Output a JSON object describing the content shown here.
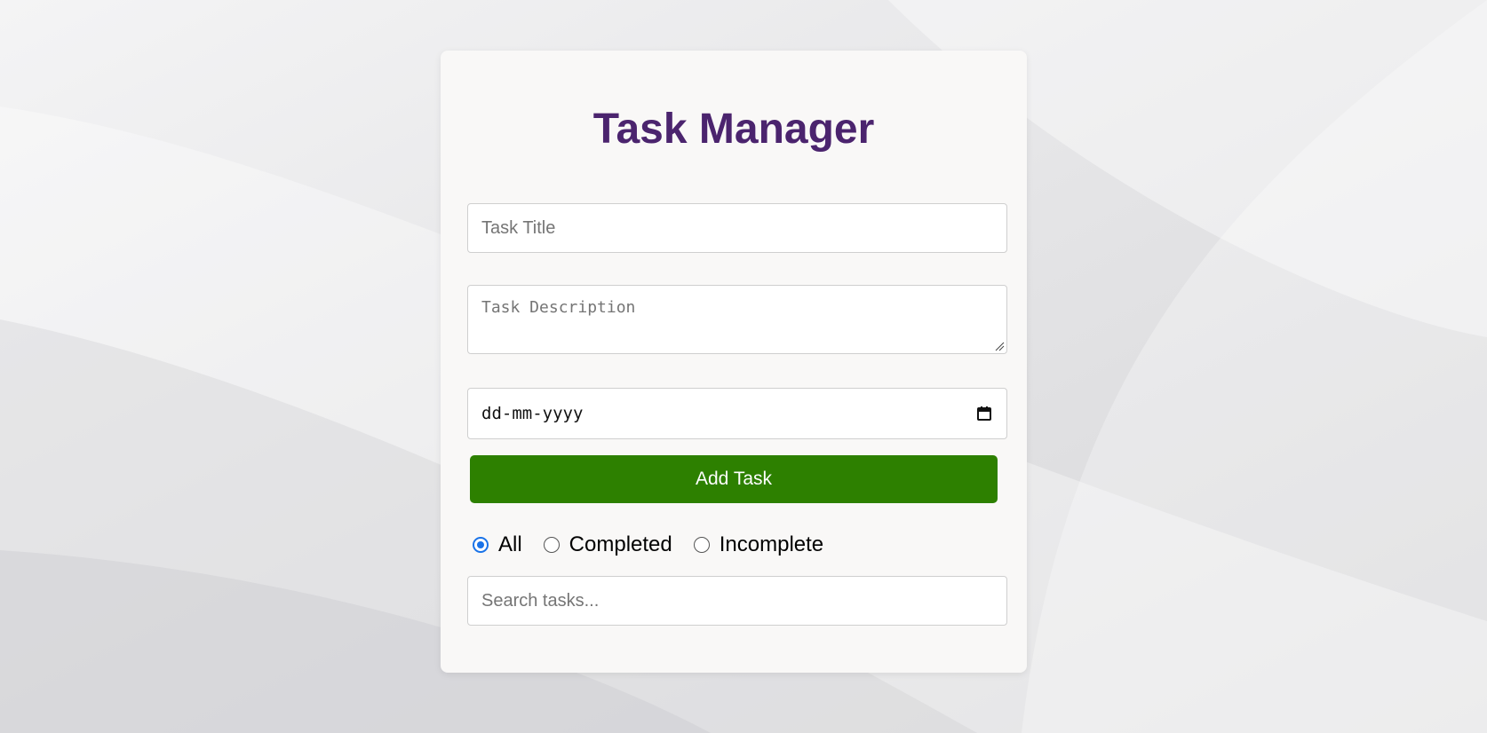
{
  "app": {
    "title": "Task Manager"
  },
  "form": {
    "title_placeholder": "Task Title",
    "description_placeholder": "Task Description",
    "date_placeholder": "dd-mm-yyyy",
    "add_button_label": "Add Task"
  },
  "filters": [
    {
      "label": "All",
      "selected": true
    },
    {
      "label": "Completed",
      "selected": false
    },
    {
      "label": "Incomplete",
      "selected": false
    }
  ],
  "search": {
    "placeholder": "Search tasks..."
  },
  "colors": {
    "title": "#4b246e",
    "button": "#2d8000",
    "radio_selected": "#1a73e8",
    "card": "#f9f8f7"
  }
}
